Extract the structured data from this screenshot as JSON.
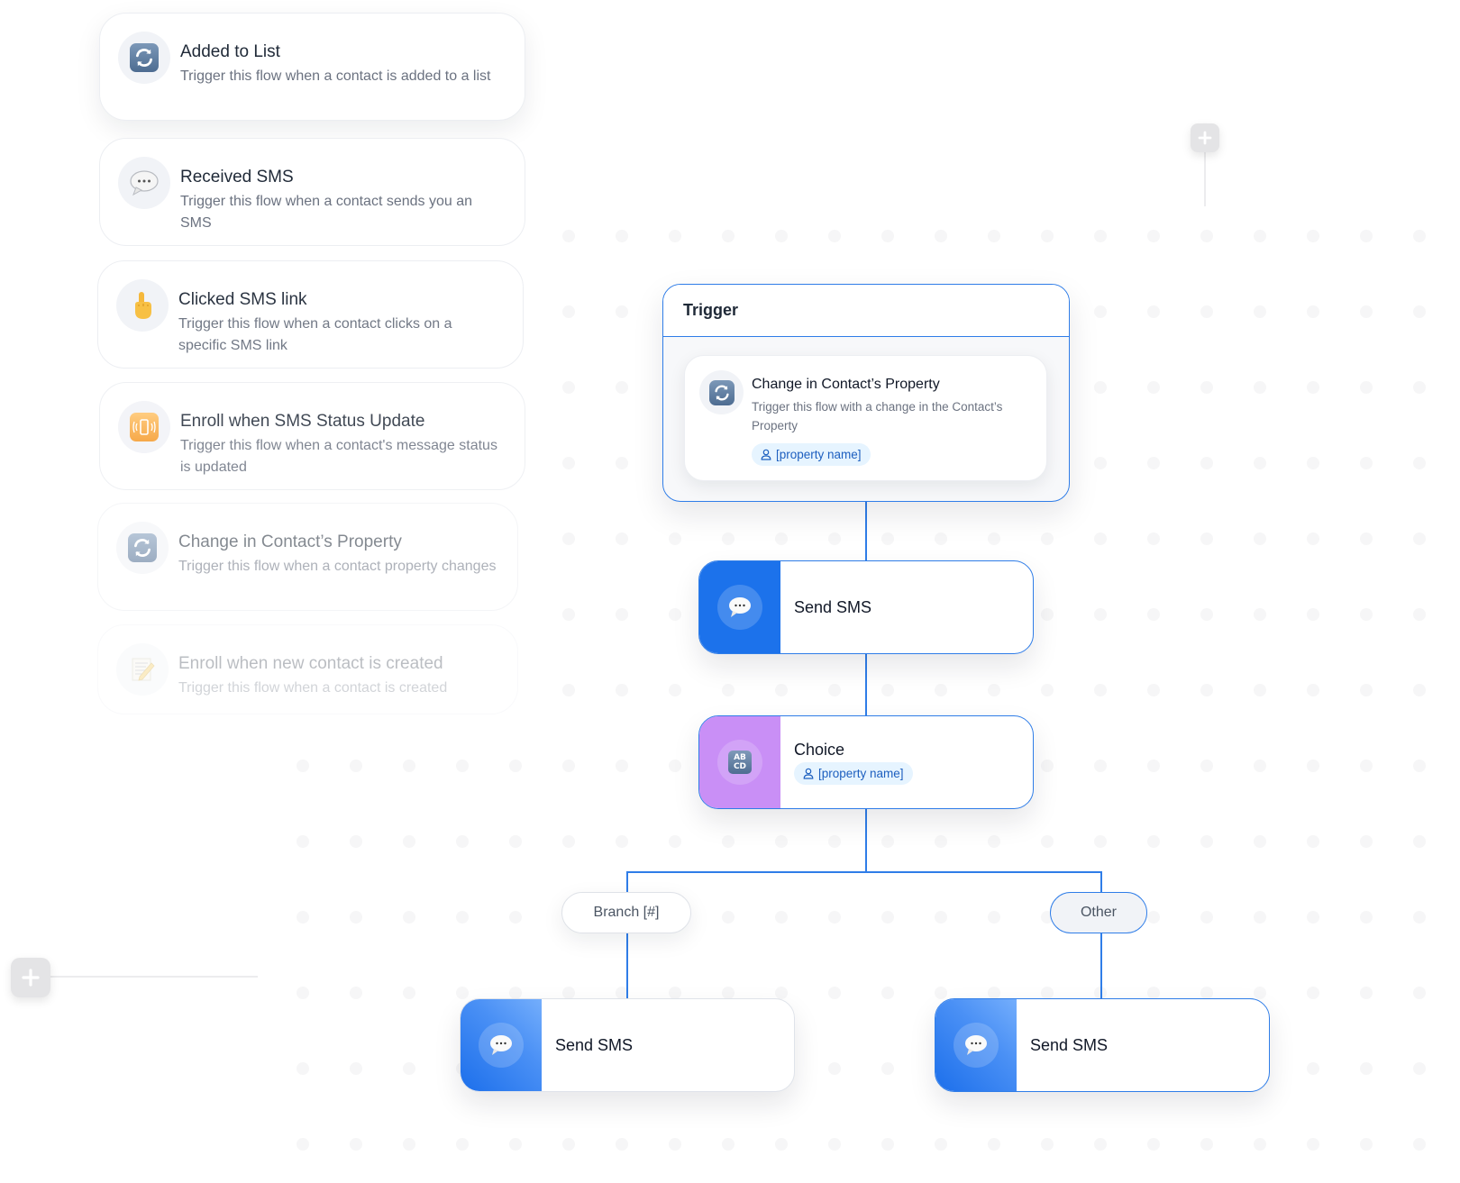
{
  "trigger_list": [
    {
      "title": "Added to List",
      "description": "Trigger this flow when a contact is added to a list",
      "icon": "refresh-arrows-icon",
      "opacity": 1.0
    },
    {
      "title": "Received SMS",
      "description": "Trigger this flow when a contact sends you an SMS",
      "icon": "speech-bubble-icon",
      "opacity": 1.0
    },
    {
      "title": "Clicked SMS link",
      "description": "Trigger this flow when a contact clicks on a specific SMS link",
      "icon": "pointing-finger-icon",
      "opacity": 0.95
    },
    {
      "title": "Enroll when SMS Status Update",
      "description": "Trigger this flow when a contact's message status is updated",
      "icon": "vibrating-phone-icon",
      "opacity": 0.85
    },
    {
      "title": "Change in Contact’s Property",
      "description": "Trigger this flow when a contact property changes",
      "icon": "refresh-arrows-icon",
      "opacity": 0.55
    },
    {
      "title": "Enroll when new contact is created",
      "description": "Trigger this flow when a contact is created",
      "icon": "memo-pencil-icon",
      "opacity": 0.3
    }
  ],
  "flow": {
    "trigger": {
      "header": "Trigger",
      "title": "Change in Contact’s Property",
      "description": "Trigger this flow with a change in the Contact’s Property",
      "tag": "[property name]"
    },
    "send_sms_1": {
      "label": "Send SMS"
    },
    "choice": {
      "label": "Choice",
      "tag": "[property name]"
    },
    "branches": [
      {
        "label": "Branch [#]",
        "state": "default"
      },
      {
        "label": "Other",
        "state": "selected"
      }
    ],
    "send_sms_branch": {
      "label": "Send SMS"
    },
    "send_sms_other": {
      "label": "Send SMS"
    }
  },
  "colors": {
    "accent": "#2f7de8",
    "sms_node": "#1c72eb",
    "choice_node": "#c98ff6",
    "tag_bg": "#e6f4ff",
    "tag_text": "#1d5fbf"
  }
}
